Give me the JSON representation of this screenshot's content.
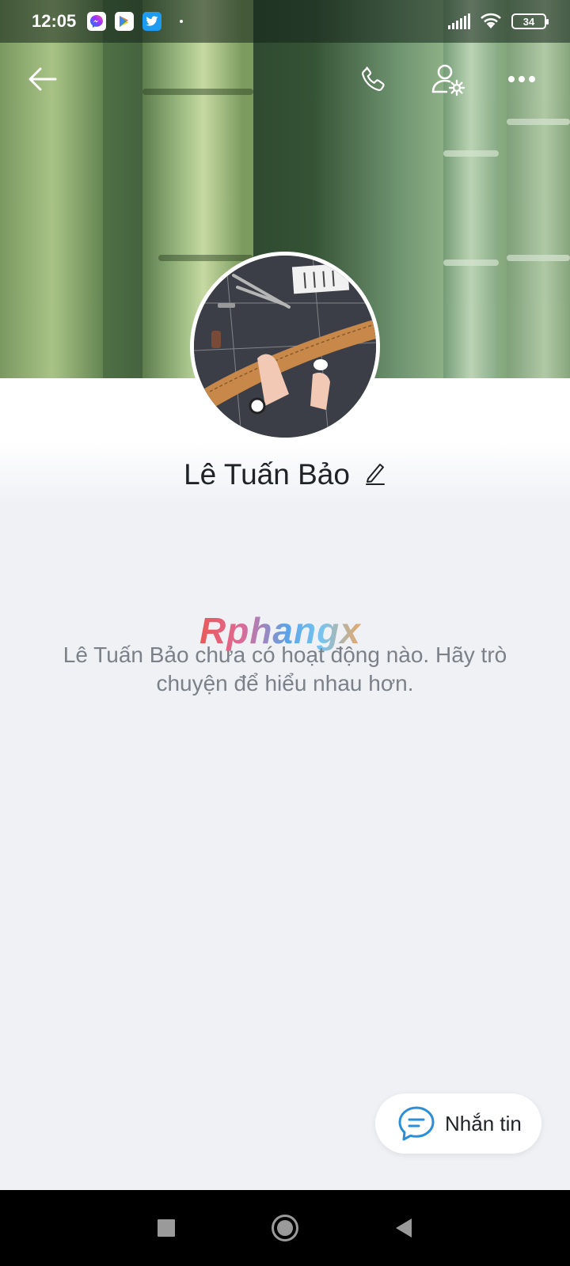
{
  "status_bar": {
    "time": "12:05",
    "notification_icons": [
      "messenger-icon",
      "play-store-icon",
      "twitter-icon"
    ],
    "battery": "34"
  },
  "top_actions": {
    "back_icon": "arrow-left-icon",
    "call_icon": "phone-icon",
    "profile_settings_icon": "user-settings-icon",
    "more_icon": "more-horizontal-icon"
  },
  "profile": {
    "name": "Lê Tuấn Bảo",
    "edit_icon": "pencil-icon"
  },
  "watermark": "Rphangx",
  "feed": {
    "empty_message": "Lê Tuấn Bảo chưa có hoạt động nào. Hãy trò chuyện để hiểu nhau hơn."
  },
  "message_button": {
    "label": "Nhắn tin",
    "icon": "chat-bubble-icon"
  },
  "nav": {
    "recents": "square-icon",
    "home": "circle-icon",
    "back": "triangle-back-icon"
  },
  "colors": {
    "accent": "#0068ff",
    "background": "#eff1f5",
    "text_secondary": "#7b818a"
  }
}
